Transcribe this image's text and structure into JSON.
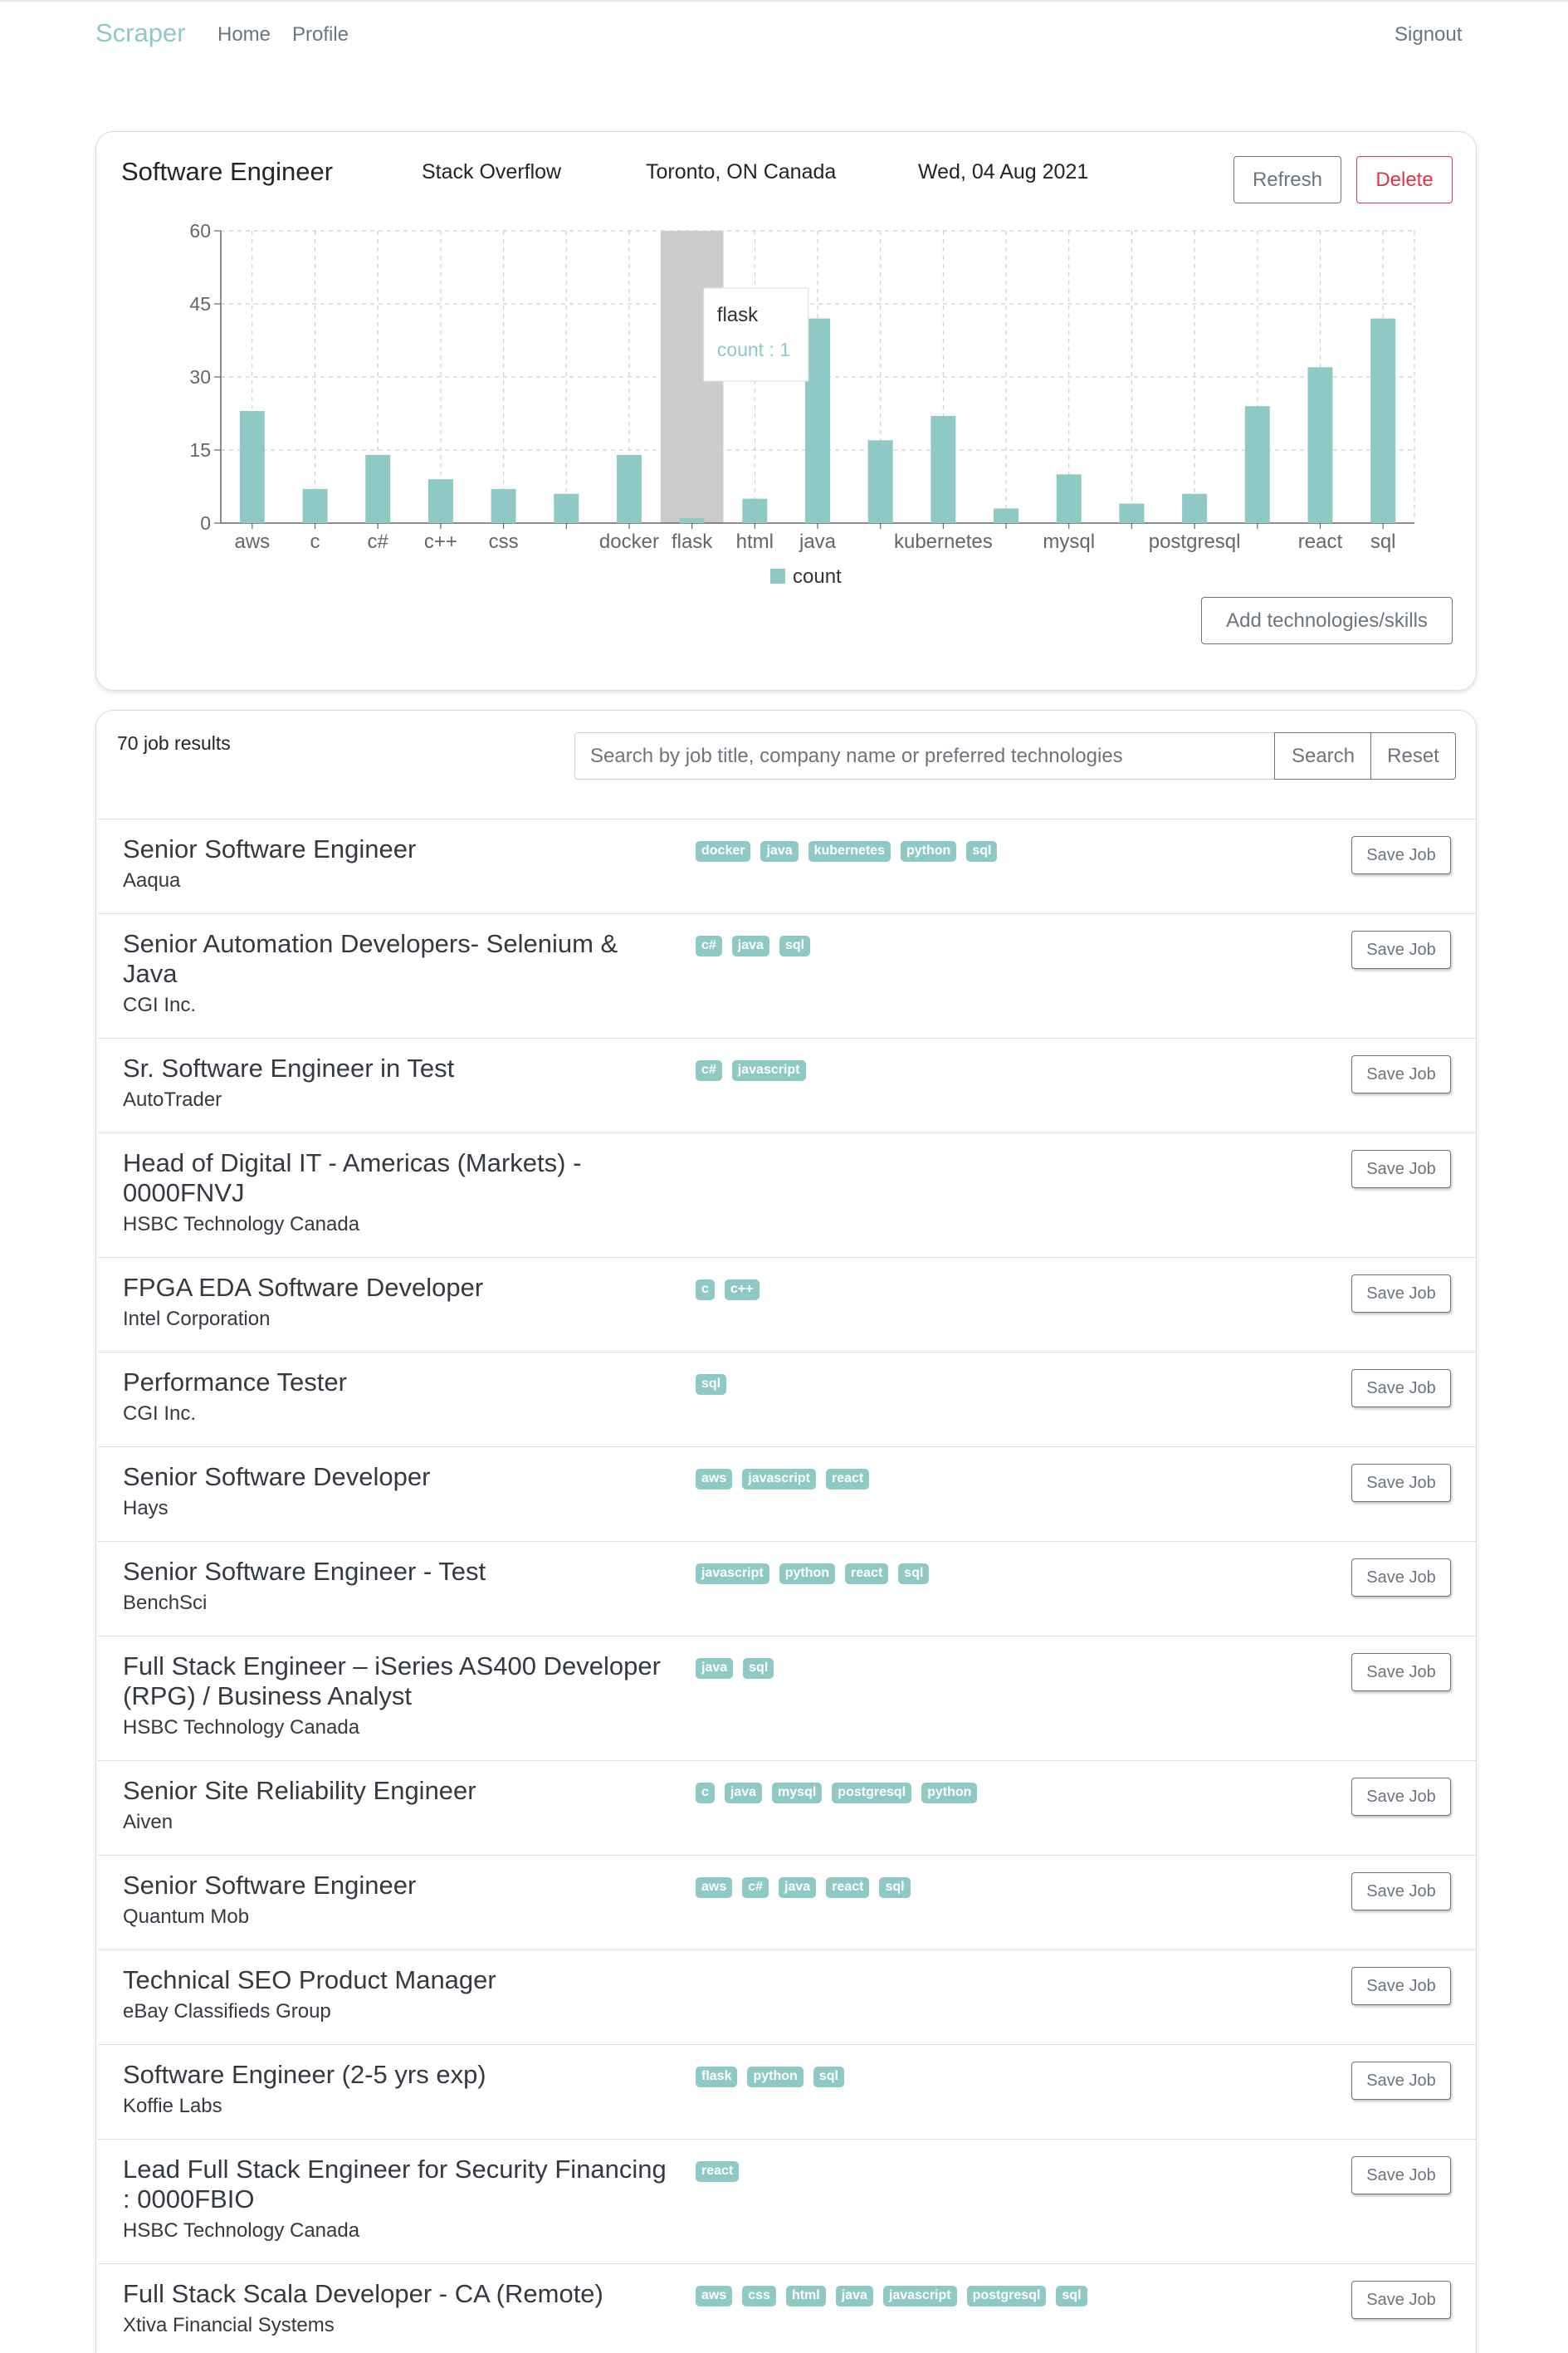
{
  "nav": {
    "brand": "Scraper",
    "home": "Home",
    "profile": "Profile",
    "signout": "Signout"
  },
  "summary": {
    "title": "Software Engineer",
    "source": "Stack Overflow",
    "location": "Toronto, ON Canada",
    "date": "Wed, 04 Aug 2021",
    "refresh_label": "Refresh",
    "delete_label": "Delete",
    "add_tech_label": "Add technologies/skills"
  },
  "chart_data": {
    "type": "bar",
    "categories": [
      "aws",
      "c",
      "c#",
      "c++",
      "css",
      "",
      "docker",
      "flask",
      "html",
      "java",
      "",
      "kubernetes",
      "",
      "mysql",
      "",
      "postgresql",
      "",
      "react",
      "sql"
    ],
    "series": [
      {
        "name": "count",
        "values": [
          23,
          7,
          14,
          9,
          7,
          6,
          14,
          1,
          5,
          42,
          17,
          22,
          3,
          10,
          4,
          6,
          24,
          32,
          42
        ]
      }
    ],
    "yticks": [
      0,
      15,
      30,
      45,
      60
    ],
    "ylim": [
      0,
      60
    ],
    "legend": "bottom",
    "grid": true,
    "color": "#8fc9c6",
    "highlight_index": 7,
    "tooltip": {
      "label": "flask",
      "value_text": "count : 1"
    }
  },
  "results": {
    "count_text": "70 job results",
    "search_placeholder": "Search by job title, company name or preferred technologies",
    "search_label": "Search",
    "reset_label": "Reset",
    "save_label": "Save Job",
    "jobs": [
      {
        "title": "Senior Software Engineer",
        "company": "Aaqua",
        "tags": [
          "docker",
          "java",
          "kubernetes",
          "python",
          "sql"
        ]
      },
      {
        "title": "Senior Automation Developers- Selenium & Java",
        "company": "CGI Inc.",
        "tags": [
          "c#",
          "java",
          "sql"
        ]
      },
      {
        "title": "Sr. Software Engineer in Test",
        "company": "AutoTrader",
        "tags": [
          "c#",
          "javascript"
        ]
      },
      {
        "title": "Head of Digital IT - Americas (Markets) - 0000FNVJ",
        "company": "HSBC Technology Canada",
        "tags": []
      },
      {
        "title": "FPGA EDA Software Developer",
        "company": "Intel Corporation",
        "tags": [
          "c",
          "c++"
        ]
      },
      {
        "title": "Performance Tester",
        "company": "CGI Inc.",
        "tags": [
          "sql"
        ]
      },
      {
        "title": "Senior Software Developer",
        "company": "Hays",
        "tags": [
          "aws",
          "javascript",
          "react"
        ]
      },
      {
        "title": "Senior Software Engineer - Test",
        "company": "BenchSci",
        "tags": [
          "javascript",
          "python",
          "react",
          "sql"
        ]
      },
      {
        "title": "Full Stack Engineer – iSeries AS400 Developer (RPG) / Business Analyst",
        "company": "HSBC Technology Canada",
        "tags": [
          "java",
          "sql"
        ]
      },
      {
        "title": "Senior Site Reliability Engineer",
        "company": "Aiven",
        "tags": [
          "c",
          "java",
          "mysql",
          "postgresql",
          "python"
        ]
      },
      {
        "title": "Senior Software Engineer",
        "company": "Quantum Mob",
        "tags": [
          "aws",
          "c#",
          "java",
          "react",
          "sql"
        ]
      },
      {
        "title": "Technical SEO Product Manager",
        "company": "eBay Classifieds Group",
        "tags": []
      },
      {
        "title": "Software Engineer (2-5 yrs exp)",
        "company": "Koffie Labs",
        "tags": [
          "flask",
          "python",
          "sql"
        ]
      },
      {
        "title": "Lead Full Stack Engineer for Security Financing : 0000FBIO",
        "company": "HSBC Technology Canada",
        "tags": [
          "react"
        ]
      },
      {
        "title": "Full Stack Scala Developer - CA (Remote)",
        "company": "Xtiva Financial Systems",
        "tags": [
          "aws",
          "css",
          "html",
          "java",
          "javascript",
          "postgresql",
          "sql"
        ]
      }
    ]
  }
}
